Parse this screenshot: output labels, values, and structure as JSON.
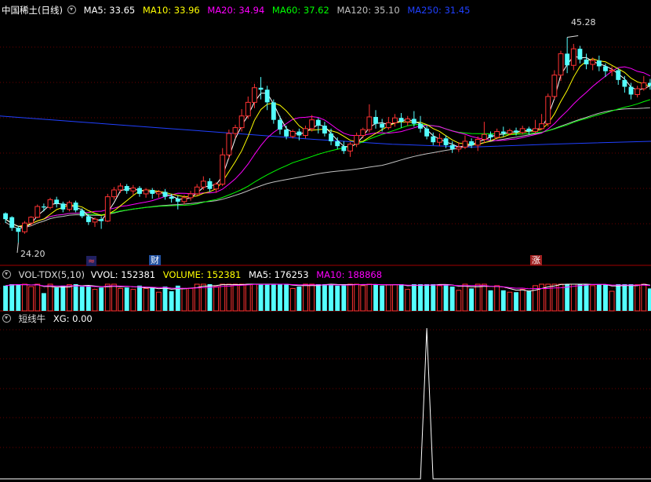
{
  "main_panel": {
    "title": "中国稀土(日线)",
    "ma": [
      {
        "label": "MA5: 33.65",
        "color": "#ffffff"
      },
      {
        "label": "MA10: 33.96",
        "color": "#ffff00"
      },
      {
        "label": "MA20: 34.94",
        "color": "#ff00ff"
      },
      {
        "label": "MA60: 37.62",
        "color": "#00ff00"
      },
      {
        "label": "MA120: 35.10",
        "color": "#c0c0c0"
      },
      {
        "label": "MA250: 31.45",
        "color": "#2040ff"
      }
    ],
    "high_label": "45.28",
    "low_label": "24.20",
    "markers": [
      "≈",
      "财",
      "涨"
    ],
    "price_range": [
      22.5,
      47.5
    ],
    "candles": [
      [
        27.2,
        26.6,
        27.3,
        26.2
      ],
      [
        26.8,
        25.7,
        26.9,
        25.4
      ],
      [
        25.7,
        25.3,
        25.9,
        24.2
      ],
      [
        25.3,
        26.2,
        26.4,
        25.1
      ],
      [
        26.2,
        26.8,
        26.9,
        25.9
      ],
      [
        26.8,
        27.9,
        28.1,
        26.7
      ],
      [
        27.9,
        27.8,
        28.2,
        27.4
      ],
      [
        27.8,
        28.6,
        28.8,
        27.6
      ],
      [
        28.6,
        28.2,
        28.9,
        27.8
      ],
      [
        28.2,
        27.6,
        28.4,
        27.3
      ],
      [
        27.6,
        28.3,
        28.5,
        27.4
      ],
      [
        28.3,
        27.5,
        28.5,
        27.3
      ],
      [
        27.5,
        26.9,
        27.7,
        26.7
      ],
      [
        26.9,
        26.3,
        27.1,
        26.0
      ],
      [
        26.3,
        26.6,
        26.8,
        25.8
      ],
      [
        26.6,
        26.4,
        26.9,
        25.6
      ],
      [
        26.4,
        28.9,
        29.2,
        26.3
      ],
      [
        28.9,
        29.6,
        29.9,
        28.6
      ],
      [
        29.6,
        30.0,
        30.3,
        29.3
      ],
      [
        30.0,
        29.5,
        30.2,
        29.2
      ],
      [
        29.5,
        29.8,
        30.1,
        29.1
      ],
      [
        29.8,
        29.2,
        30.0,
        28.9
      ],
      [
        29.2,
        29.6,
        29.8,
        28.8
      ],
      [
        29.6,
        29.2,
        29.8,
        28.7
      ],
      [
        29.2,
        29.4,
        29.6,
        28.8
      ],
      [
        29.4,
        28.9,
        29.7,
        28.6
      ],
      [
        28.9,
        28.7,
        29.2,
        28.3
      ],
      [
        28.7,
        28.4,
        29.0,
        27.6
      ],
      [
        28.4,
        28.8,
        29.1,
        28.1
      ],
      [
        28.8,
        29.2,
        29.5,
        28.5
      ],
      [
        29.2,
        29.9,
        30.2,
        29.0
      ],
      [
        29.9,
        30.5,
        31.0,
        29.6
      ],
      [
        30.5,
        29.7,
        30.8,
        29.4
      ],
      [
        29.7,
        30.2,
        30.4,
        29.3
      ],
      [
        30.2,
        33.2,
        33.9,
        30.0
      ],
      [
        33.2,
        35.4,
        35.8,
        32.8
      ],
      [
        35.4,
        36.0,
        36.3,
        34.9
      ],
      [
        36.0,
        37.2,
        37.9,
        35.6
      ],
      [
        37.2,
        38.6,
        39.2,
        36.9
      ],
      [
        38.6,
        40.1,
        40.5,
        38.0
      ],
      [
        40.1,
        39.9,
        41.2,
        38.9
      ],
      [
        39.9,
        38.6,
        40.3,
        37.8
      ],
      [
        38.6,
        36.8,
        38.9,
        36.4
      ],
      [
        36.8,
        35.8,
        37.2,
        35.3
      ],
      [
        35.8,
        35.1,
        36.2,
        34.8
      ],
      [
        35.1,
        35.6,
        35.8,
        34.9
      ],
      [
        35.6,
        35.2,
        35.9,
        34.7
      ],
      [
        35.2,
        35.9,
        36.2,
        34.9
      ],
      [
        35.9,
        36.8,
        37.3,
        35.6
      ],
      [
        36.8,
        36.2,
        37.0,
        35.4
      ],
      [
        36.2,
        35.4,
        36.6,
        35.1
      ],
      [
        35.4,
        34.6,
        35.9,
        34.2
      ],
      [
        34.6,
        34.1,
        35.0,
        33.8
      ],
      [
        34.1,
        33.6,
        34.6,
        33.3
      ],
      [
        33.6,
        34.3,
        34.5,
        33.0
      ],
      [
        34.3,
        35.2,
        35.5,
        34.0
      ],
      [
        35.2,
        35.8,
        36.0,
        34.9
      ],
      [
        35.8,
        37.1,
        38.4,
        35.5
      ],
      [
        37.1,
        36.4,
        37.8,
        35.9
      ],
      [
        36.4,
        36.0,
        36.9,
        35.6
      ],
      [
        36.0,
        36.5,
        37.1,
        35.8
      ],
      [
        36.5,
        37.0,
        37.4,
        36.1
      ],
      [
        37.0,
        36.6,
        37.5,
        36.0
      ],
      [
        36.6,
        36.9,
        37.2,
        36.2
      ],
      [
        36.9,
        36.4,
        37.7,
        36.1
      ],
      [
        36.4,
        35.9,
        37.2,
        35.5
      ],
      [
        35.9,
        35.1,
        36.2,
        34.8
      ],
      [
        35.1,
        34.5,
        35.5,
        34.2
      ],
      [
        34.5,
        34.9,
        35.4,
        34.1
      ],
      [
        34.9,
        34.2,
        35.2,
        33.9
      ],
      [
        34.2,
        33.8,
        34.6,
        33.4
      ],
      [
        33.8,
        34.0,
        34.5,
        33.5
      ],
      [
        34.0,
        34.6,
        35.2,
        33.8
      ],
      [
        34.6,
        34.2,
        34.9,
        33.9
      ],
      [
        34.2,
        34.8,
        35.1,
        33.6
      ],
      [
        34.8,
        35.3,
        36.6,
        34.4
      ],
      [
        35.3,
        35.0,
        35.6,
        34.7
      ],
      [
        35.0,
        35.6,
        35.9,
        34.8
      ],
      [
        35.6,
        35.4,
        36.1,
        35.1
      ],
      [
        35.4,
        35.7,
        35.9,
        35.2
      ],
      [
        35.7,
        35.5,
        36.0,
        35.2
      ],
      [
        35.5,
        35.9,
        36.2,
        35.3
      ],
      [
        35.9,
        35.6,
        36.1,
        35.3
      ],
      [
        35.6,
        35.9,
        36.8,
        35.4
      ],
      [
        35.9,
        36.4,
        37.4,
        35.8
      ],
      [
        36.4,
        39.2,
        39.5,
        36.1
      ],
      [
        39.2,
        41.4,
        41.9,
        38.9
      ],
      [
        41.4,
        43.6,
        43.9,
        40.8
      ],
      [
        43.6,
        42.4,
        45.28,
        41.6
      ],
      [
        42.4,
        44.1,
        44.6,
        41.9
      ],
      [
        44.1,
        43.0,
        44.4,
        42.6
      ],
      [
        43.0,
        42.5,
        43.6,
        42.0
      ],
      [
        42.5,
        42.9,
        43.2,
        41.9
      ],
      [
        42.9,
        42.3,
        43.4,
        41.8
      ],
      [
        42.3,
        41.8,
        42.6,
        41.2
      ],
      [
        41.8,
        41.9,
        42.3,
        41.3
      ],
      [
        41.9,
        40.9,
        42.1,
        40.4
      ],
      [
        40.9,
        40.2,
        41.3,
        39.6
      ],
      [
        40.2,
        39.4,
        40.6,
        38.9
      ],
      [
        39.4,
        40.0,
        40.3,
        39.1
      ],
      [
        40.0,
        40.6,
        41.3,
        39.8
      ],
      [
        40.6,
        40.3,
        41.0,
        39.9
      ]
    ],
    "ma250": [
      [
        0,
        37.2
      ],
      [
        100,
        36.6
      ],
      [
        200,
        36.0
      ],
      [
        300,
        35.4
      ],
      [
        400,
        34.8
      ],
      [
        500,
        34.3
      ],
      [
        600,
        34.0
      ],
      [
        700,
        34.3
      ],
      [
        830,
        34.6
      ]
    ]
  },
  "vol_panel": {
    "title": "VOL-TDX(5,10)",
    "legend": [
      {
        "label": "VVOL: 152381",
        "color": "#ffffff"
      },
      {
        "label": "VOLUME: 152381",
        "color": "#ffff00"
      },
      {
        "label": "MA5: 176253",
        "color": "#ffffff"
      },
      {
        "label": "MA10: 188868",
        "color": "#ff00ff"
      }
    ]
  },
  "sig_panel": {
    "title": "短线牛",
    "legend": [
      {
        "label": "XG: 0.00",
        "color": "#ffffff"
      }
    ],
    "signal_index": 66
  }
}
